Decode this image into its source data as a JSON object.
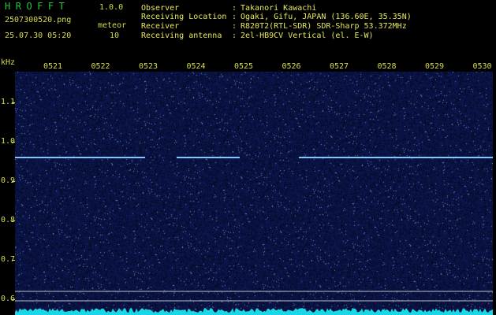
{
  "app": {
    "name": "HROFFT",
    "version": "1.0.0"
  },
  "file": {
    "name": "2507300520.png",
    "datetime": "25.07.30 05:20"
  },
  "meteor": {
    "label": "meteor",
    "count": "10"
  },
  "info": [
    {
      "label": "Observer",
      "value": "Takanori Kawachi"
    },
    {
      "label": "Receiving Location",
      "value": "Ogaki, Gifu, JAPAN (136.60E, 35.35N)"
    },
    {
      "label": "Receiver",
      "value": "R820T2(RTL-SDR) SDR-Sharp 53.372MHz"
    },
    {
      "label": "Receiving antenna",
      "value": "2el-HB9CV Vertical (el. E-W)"
    }
  ],
  "colors": {
    "label_yellow": "#d7dc4e",
    "title_green": "#27c53c",
    "background": "#05062e"
  },
  "chart_data": {
    "type": "heatmap",
    "ylabel": "kHz",
    "y_ticks": [
      "1.1",
      "1.0",
      "0.9",
      "0.8",
      "0.7",
      "0.6"
    ],
    "x_ticks": [
      "0521",
      "0522",
      "0523",
      "0524",
      "0525",
      "0526",
      "0527",
      "0528",
      "0529",
      "0530"
    ],
    "ylim": [
      0.58,
      1.19
    ],
    "carrier_khz": 0.96
  }
}
